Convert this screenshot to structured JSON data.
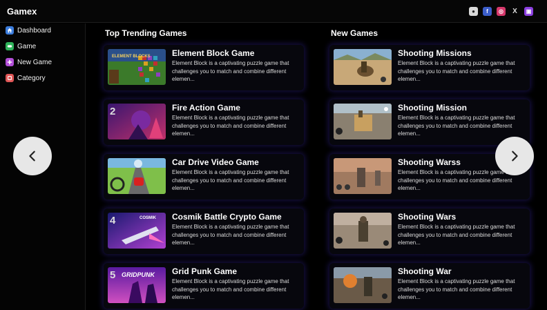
{
  "app": {
    "title": "Gamex"
  },
  "social": [
    {
      "name": "user-icon",
      "glyph": "●"
    },
    {
      "name": "facebook-icon",
      "glyph": "f"
    },
    {
      "name": "instagram-icon",
      "glyph": "◎"
    },
    {
      "name": "x-icon",
      "glyph": "X"
    },
    {
      "name": "twitch-icon",
      "glyph": "▣"
    }
  ],
  "sidebar": {
    "items": [
      {
        "label": "Dashboard",
        "color": "#3b7ddd",
        "icon": "home-icon"
      },
      {
        "label": "Game",
        "color": "#2fb35a",
        "icon": "gamepad-icon"
      },
      {
        "label": "New Game",
        "color": "#b34fd9",
        "icon": "plus-icon"
      },
      {
        "label": "Category",
        "color": "#e05656",
        "icon": "category-icon"
      }
    ]
  },
  "trending": {
    "title": "Top Trending Games",
    "games": [
      {
        "title": "Element Block Game",
        "desc": "Element Block is a captivating puzzle game that challenges you to match and combine different elemen..."
      },
      {
        "title": "Fire Action Game",
        "desc": "Element Block is a captivating puzzle game that challenges you to match and combine different elemen..."
      },
      {
        "title": "Car Drive Video Game",
        "desc": "Element Block is a captivating puzzle game that challenges you to match and combine different elemen..."
      },
      {
        "title": "Cosmik Battle Crypto Game",
        "desc": "Element Block is a captivating puzzle game that challenges you to match and combine different elemen..."
      },
      {
        "title": "Grid Punk Game",
        "desc": "Element Block is a captivating puzzle game that challenges you to match and combine different elemen..."
      }
    ]
  },
  "new_games": {
    "title": "New Games",
    "games": [
      {
        "title": "Shooting Missions",
        "desc": "Element Block is a captivating puzzle game that challenges you to match and combine different elemen..."
      },
      {
        "title": "Shooting Mission",
        "desc": "Element Block is a captivating puzzle game that challenges you to match and combine different elemen..."
      },
      {
        "title": "Shooting Warss",
        "desc": "Element Block is a captivating puzzle game that challenges you to match and combine different elemen..."
      },
      {
        "title": "Shooting Wars",
        "desc": "Element Block is a captivating puzzle game that challenges you to match and combine different elemen..."
      },
      {
        "title": "Shooting War",
        "desc": "Element Block is a captivating puzzle game that challenges you to match and combine different elemen..."
      }
    ]
  },
  "thumb_labels": {
    "t1": "ELEMENT BLOCKS",
    "t2": "2",
    "t4": "4",
    "t4b": "COSMIK",
    "t5": "5",
    "t5b": "GRIDPUNK"
  },
  "colors": {
    "accent_glow": "#2a1e78",
    "background": "#000000"
  }
}
